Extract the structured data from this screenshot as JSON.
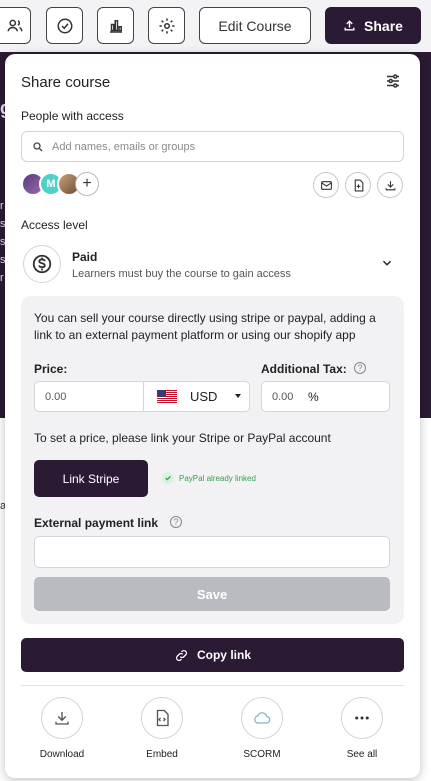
{
  "toolbar": {
    "edit_label": "Edit Course",
    "share_label": "Share"
  },
  "background": {
    "letters": [
      "g",
      "r",
      "s",
      "s",
      "s",
      "r",
      "a"
    ]
  },
  "panel": {
    "title": "Share course",
    "people_label": "People with access",
    "search_placeholder": "Add names, emails or groups",
    "avatars": [
      "",
      "M",
      ""
    ],
    "add_symbol": "+",
    "access_label": "Access level",
    "access_title": "Paid",
    "access_desc": "Learners must buy the course to gain access",
    "info_text": "You can sell your course directly using stripe or paypal, adding a link to an external payment platform or using our shopify app",
    "price_label": "Price:",
    "price_value": "0.00",
    "currency": "USD",
    "tax_label": "Additional Tax:",
    "tax_value": "0.00",
    "tax_unit": "%",
    "link_text": "To set a price, please link your Stripe or PayPal account",
    "stripe_button": "Link Stripe",
    "paypal_status": "PayPal already linked",
    "external_label": "External payment link",
    "save_label": "Save",
    "copy_label": "Copy link",
    "help_symbol": "?",
    "actions": [
      {
        "label": "Download",
        "icon": "download-icon"
      },
      {
        "label": "Embed",
        "icon": "embed-icon"
      },
      {
        "label": "SCORM",
        "icon": "cloud-icon"
      },
      {
        "label": "See all",
        "icon": "more-icon"
      }
    ]
  },
  "colors": {
    "primary": "#2a1a33",
    "disabled": "#b9bbc0",
    "success": "#3c9b52"
  }
}
